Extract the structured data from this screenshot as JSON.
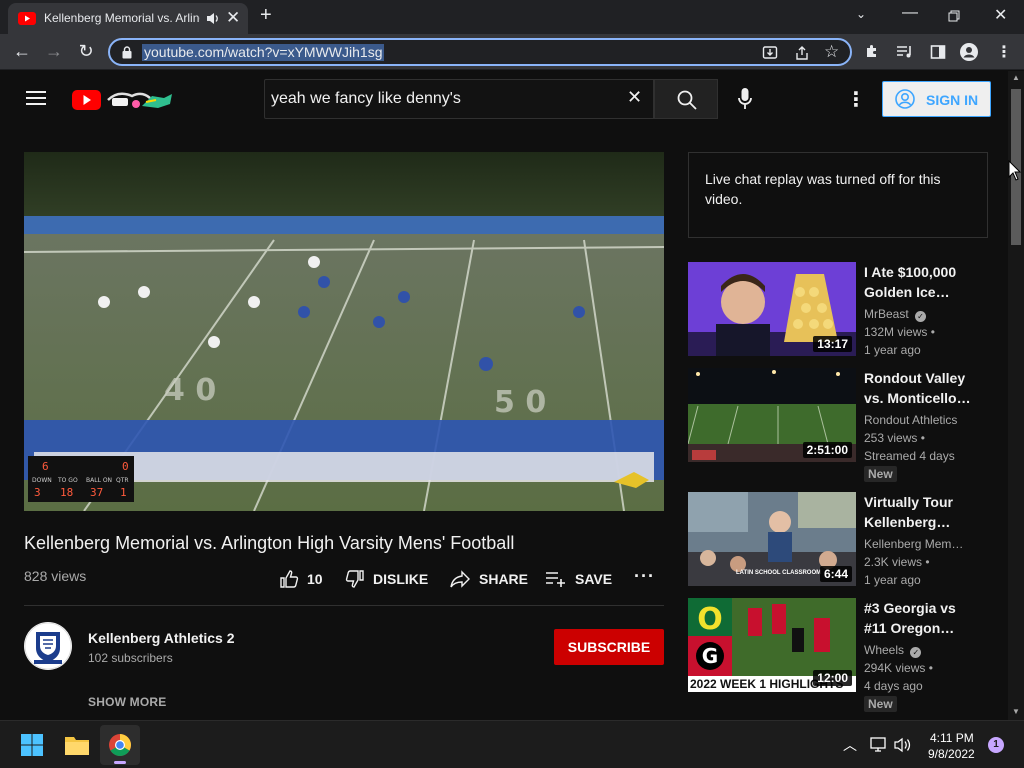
{
  "browser": {
    "tab_title": "Kellenberg Memorial vs. Arlington",
    "url": "youtube.com/watch?v=xYMWWJih1sg"
  },
  "youtube": {
    "search_query": "yeah we fancy like denny's",
    "sign_in_label": "SIGN IN"
  },
  "video": {
    "title": "Kellenberg Memorial vs. Arlington High Varsity Mens' Football",
    "views": "828 views",
    "like_count": "10",
    "dislike_label": "DISLIKE",
    "share_label": "SHARE",
    "save_label": "SAVE",
    "scoreboard": {
      "top": "6",
      "down_label": "DOWN",
      "togo_label": "TO GO",
      "ballon_label": "BALL ON",
      "qtr_label": "QTR",
      "down": "3",
      "togo": "18",
      "ballon": "37",
      "qtr": "1",
      "home": "0"
    }
  },
  "channel": {
    "name": "Kellenberg Athletics 2",
    "subscribers": "102 subscribers",
    "subscribe_label": "SUBSCRIBE",
    "show_more_label": "SHOW MORE"
  },
  "chat": {
    "message": "Live chat replay was turned off for this video."
  },
  "related": [
    {
      "title": "I Ate $100,000 Golden Ice…",
      "channel": "MrBeast",
      "verified": true,
      "views": "132M views •",
      "age": "1 year ago",
      "duration": "13:17",
      "badge": ""
    },
    {
      "title": "Rondout Valley vs. Monticello…",
      "channel": "Rondout Athletics",
      "verified": false,
      "views": "253 views •",
      "age": "Streamed 4 days",
      "duration": "2:51:00",
      "badge": "New"
    },
    {
      "title": "Virtually Tour Kellenberg…",
      "channel": "Kellenberg Mem…",
      "verified": false,
      "views": "2.3K views •",
      "age": "1 year ago",
      "duration": "6:44",
      "badge": "",
      "thumb_caption": "LATIN SCHOOL CLASSROOM"
    },
    {
      "title": "#3 Georgia vs #11 Oregon…",
      "channel": "Wheels",
      "verified": true,
      "views": "294K views •",
      "age": "4 days ago",
      "duration": "12:00",
      "badge": "New",
      "thumb_caption": "2022 WEEK 1 HIGHLIGHTS"
    }
  ],
  "taskbar": {
    "time": "4:11 PM",
    "date": "9/8/2022",
    "notification_count": "1"
  },
  "colors": {
    "accent": "#3ea6ff",
    "subscribe": "#cc0000",
    "youtube_red": "#ff0000"
  }
}
